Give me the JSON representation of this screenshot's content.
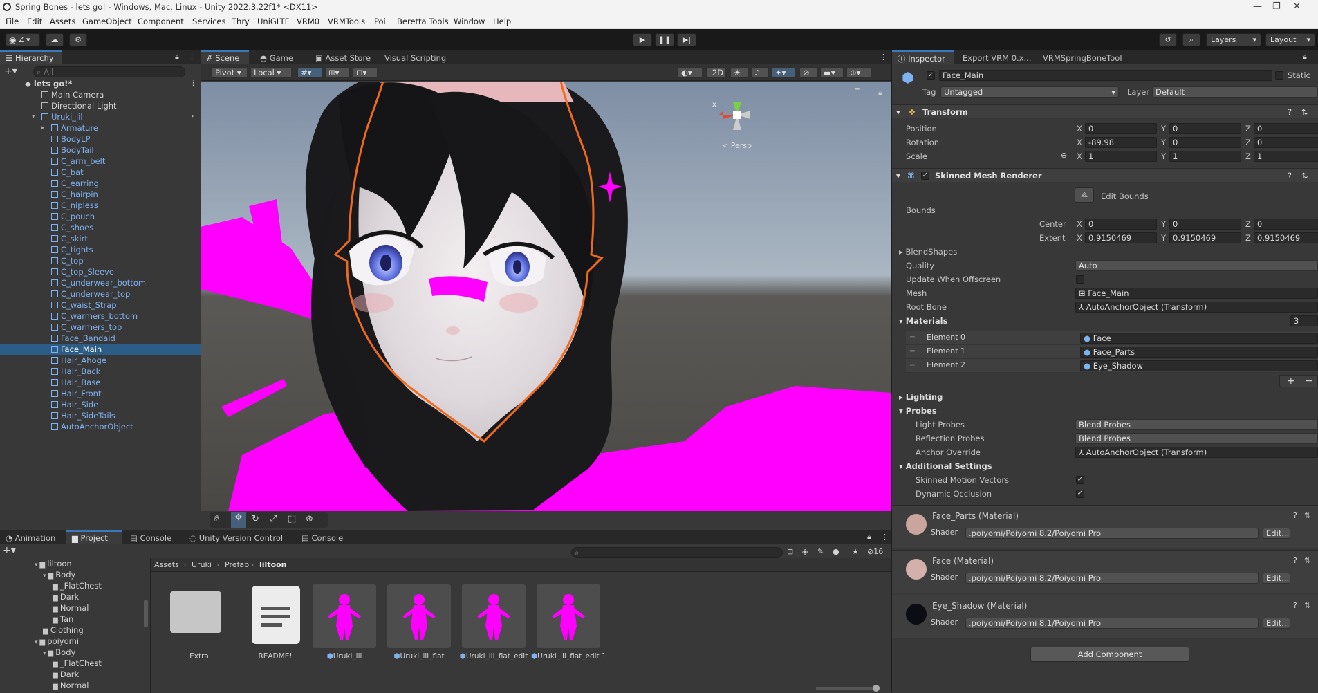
{
  "window": {
    "title": "Spring Bones - lets go! - Windows, Mac, Linux - Unity 2022.3.22f1* <DX11>"
  },
  "menu": [
    "File",
    "Edit",
    "Assets",
    "GameObject",
    "Component",
    "Services",
    "Thry",
    "UniGLTF",
    "VRM0",
    "VRMTools",
    "Poi",
    "Beretta Tools",
    "Window",
    "Help"
  ],
  "toolbar": {
    "account": "Z",
    "layers": "Layers",
    "layout": "Layout"
  },
  "hierarchy": {
    "tab": "Hierarchy",
    "search_placeholder": "All",
    "scene": "lets go!*",
    "items": [
      "Main Camera",
      "Directional Light",
      "Uruki_lil",
      "Armature",
      "BodyLP",
      "BodyTail",
      "C_arm_belt",
      "C_bat",
      "C_earring",
      "C_hairpin",
      "C_nipless",
      "C_pouch",
      "C_shoes",
      "C_skirt",
      "C_tights",
      "C_top",
      "C_top_Sleeve",
      "C_underwear_bottom",
      "C_underwear_top",
      "C_waist_Strap",
      "C_warmers_bottom",
      "C_warmers_top",
      "Face_Bandaid",
      "Face_Main",
      "Hair_Ahoge",
      "Hair_Back",
      "Hair_Base",
      "Hair_Front",
      "Hair_Side",
      "Hair_SideTails",
      "AutoAnchorObject"
    ]
  },
  "scene": {
    "tabs": [
      "Scene",
      "Game",
      "Asset Store",
      "Visual Scripting"
    ],
    "pivot": "Pivot",
    "local": "Local",
    "mode2d": "2D",
    "persp": "< Persp",
    "gizmo_x": "x"
  },
  "inspector": {
    "tabs": [
      "Inspector",
      "Export VRM 0.x...",
      "VRMSpringBoneTool"
    ],
    "object_name": "Face_Main",
    "static_label": "Static",
    "tag_label": "Tag",
    "tag": "Untagged",
    "layer_label": "Layer",
    "layer": "Default",
    "transform": {
      "title": "Transform",
      "position_label": "Position",
      "rotation_label": "Rotation",
      "scale_label": "Scale",
      "position": [
        "0",
        "0",
        "0"
      ],
      "rotation": [
        "-89.98",
        "0",
        "0"
      ],
      "scale": [
        "1",
        "1",
        "1"
      ]
    },
    "smr": {
      "title": "Skinned Mesh Renderer",
      "edit_bounds": "Edit Bounds",
      "bounds": "Bounds",
      "center": "Center",
      "extent": "Extent",
      "center_vals": [
        "0",
        "0",
        "0"
      ],
      "extent_vals": [
        "0.9150469",
        "0.9150469",
        "0.9150469"
      ],
      "blendshapes": "BlendShapes",
      "quality_label": "Quality",
      "quality": "Auto",
      "update_offscreen": "Update When Offscreen",
      "mesh_label": "Mesh",
      "mesh": "Face_Main",
      "root_bone_label": "Root Bone",
      "root_bone": "AutoAnchorObject (Transform)",
      "materials": "Materials",
      "materials_count": "3",
      "elements": [
        {
          "label": "Element 0",
          "value": "Face"
        },
        {
          "label": "Element 1",
          "value": "Face_Parts"
        },
        {
          "label": "Element 2",
          "value": "Eye_Shadow"
        }
      ],
      "lighting": "Lighting",
      "probes": "Probes",
      "light_probes_label": "Light Probes",
      "light_probes": "Blend Probes",
      "reflection_probes_label": "Reflection Probes",
      "reflection_probes": "Blend Probes",
      "anchor_override_label": "Anchor Override",
      "anchor_override": "AutoAnchorObject (Transform)",
      "additional": "Additional Settings",
      "skinned_motion": "Skinned Motion Vectors",
      "dynamic_occlusion": "Dynamic Occlusion"
    },
    "shader_label": "Shader",
    "materials_list": [
      {
        "name": "Face_Parts (Material)",
        "shader": ".poiyomi/Poiyomi 8.2/Poiyomi Pro",
        "edit": "Edit..."
      },
      {
        "name": "Face (Material)",
        "shader": ".poiyomi/Poiyomi 8.2/Poiyomi Pro",
        "edit": "Edit..."
      },
      {
        "name": "Eye_Shadow (Material)",
        "shader": ".poiyomi/Poiyomi 8.1/Poiyomi Pro",
        "edit": "Edit..."
      }
    ],
    "add_component": "Add Component"
  },
  "project": {
    "tabs": [
      "Animation",
      "Project",
      "Console",
      "Unity Version Control",
      "Console"
    ],
    "hidden_count": "16",
    "breadcrumb": [
      "Assets",
      "Uruki",
      "Prefab",
      "liltoon"
    ],
    "tree": [
      {
        "label": "liltoon",
        "indent": 1
      },
      {
        "label": "Body",
        "indent": 2
      },
      {
        "label": "_FlatChest",
        "indent": 3
      },
      {
        "label": "Dark",
        "indent": 3
      },
      {
        "label": "Normal",
        "indent": 3
      },
      {
        "label": "Tan",
        "indent": 3
      },
      {
        "label": "Clothing",
        "indent": 2
      },
      {
        "label": "poiyomi",
        "indent": 1
      },
      {
        "label": "Body",
        "indent": 2
      },
      {
        "label": "_FlatChest",
        "indent": 3
      },
      {
        "label": "Dark",
        "indent": 3
      },
      {
        "label": "Normal",
        "indent": 3
      }
    ],
    "assets": [
      "Extra",
      "README!",
      "Uruki_lil",
      "Uruki_lil_flat",
      "Uruki_lil_flat_edit",
      "Uruki_lil_flat_edit 1"
    ]
  },
  "colors": {
    "accent": "#3a79bb",
    "selection": "#2c5d87",
    "magenta": "#ff00ff",
    "outline": "#f06a1e"
  }
}
